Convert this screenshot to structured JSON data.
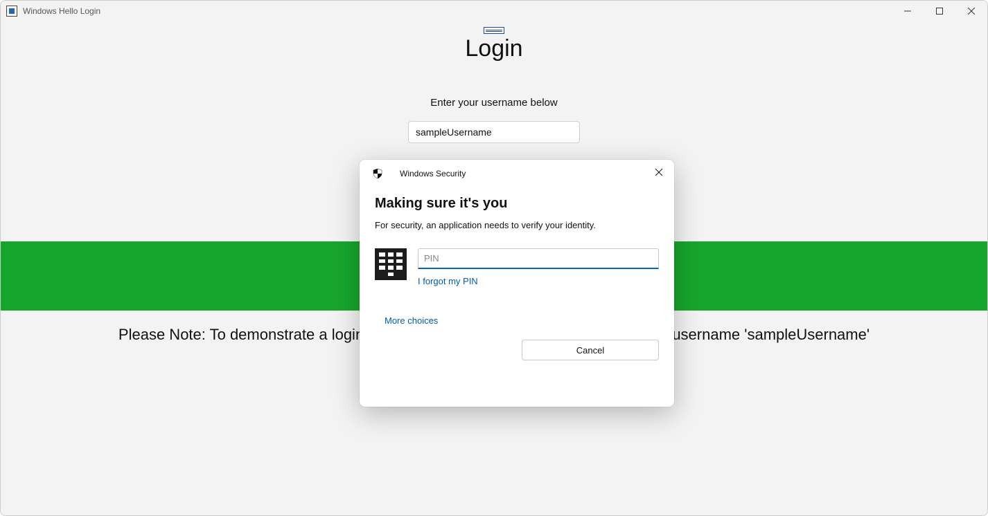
{
  "window": {
    "title": "Windows Hello Login"
  },
  "login": {
    "title": "Login",
    "subtitle": "Enter your username below",
    "username_value": "sampleUsername",
    "note": "Please Note: To demonstrate a login message when successfully logging in, input username 'sampleUsername'"
  },
  "dialog": {
    "title": "Windows Security",
    "heading": "Making sure it's you",
    "description": "For security, an application needs to verify your identity.",
    "pin_placeholder": "PIN",
    "forgot_label": "I forgot my PIN",
    "more_choices_label": "More choices",
    "cancel_label": "Cancel"
  }
}
